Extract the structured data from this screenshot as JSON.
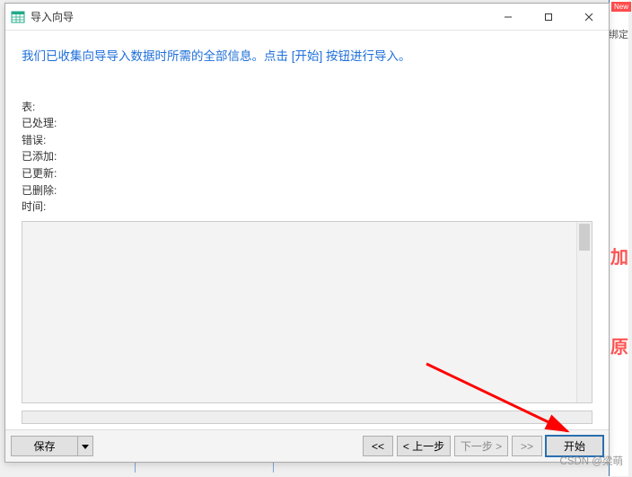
{
  "window": {
    "title": "导入向导"
  },
  "instruction": "我们已收集向导导入数据时所需的全部信息。点击 [开始] 按钮进行导入。",
  "stats": {
    "table_label": "表:",
    "processed_label": "已处理:",
    "error_label": "错误:",
    "added_label": "已添加:",
    "updated_label": "已更新:",
    "deleted_label": "已删除:",
    "time_label": "时间:",
    "table_value": "",
    "processed_value": "",
    "error_value": "",
    "added_value": "",
    "updated_value": "",
    "deleted_value": "",
    "time_value": ""
  },
  "buttons": {
    "save": "保存",
    "first": "<<",
    "prev": "< 上一步",
    "next": "下一步 >",
    "last": ">>",
    "start": "开始"
  },
  "background": {
    "badge": "New",
    "text_fragment": "绑定",
    "red1": "加",
    "red2": "原"
  },
  "watermark": "CSDN @梁萌"
}
